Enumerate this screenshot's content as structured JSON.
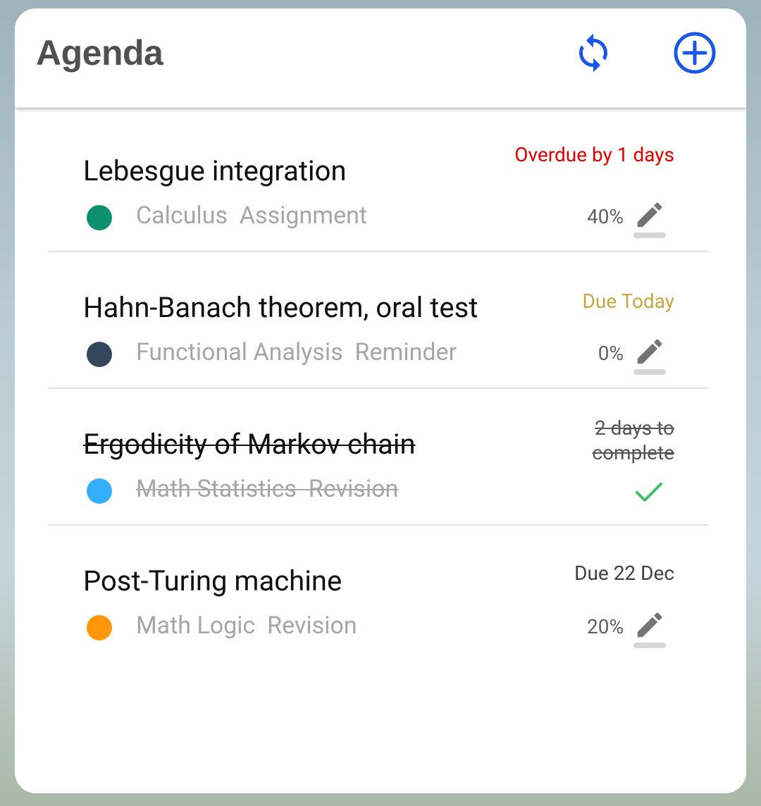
{
  "header": {
    "title": "Agenda",
    "refresh_icon": "refresh-icon",
    "add_icon": "add-circle-icon",
    "accent": "#1a57e8"
  },
  "items": [
    {
      "title": "Lebesgue integration",
      "subtitle": "Calculus  Assignment",
      "due": "Overdue by 1 days",
      "due_color": "#e00000",
      "dot_color": "#0c9170",
      "progress": "40%",
      "completed": false
    },
    {
      "title": "Hahn-Banach theorem, oral test",
      "subtitle": "Functional Analysis  Reminder",
      "due": "Due Today",
      "due_color": "#c9a642",
      "dot_color": "#33465e",
      "progress": "0%",
      "completed": false
    },
    {
      "title": "Ergodicity of Markov chain",
      "subtitle": "Math Statistics  Revision",
      "due": "2 days to complete",
      "due_color": "#555555",
      "dot_color": "#36aeff",
      "progress": "",
      "completed": true
    },
    {
      "title": "Post-Turing machine",
      "subtitle": "Math Logic  Revision",
      "due": "Due 22 Dec",
      "due_color": "#404040",
      "dot_color": "#ff9708",
      "progress": "20%",
      "completed": false
    }
  ]
}
